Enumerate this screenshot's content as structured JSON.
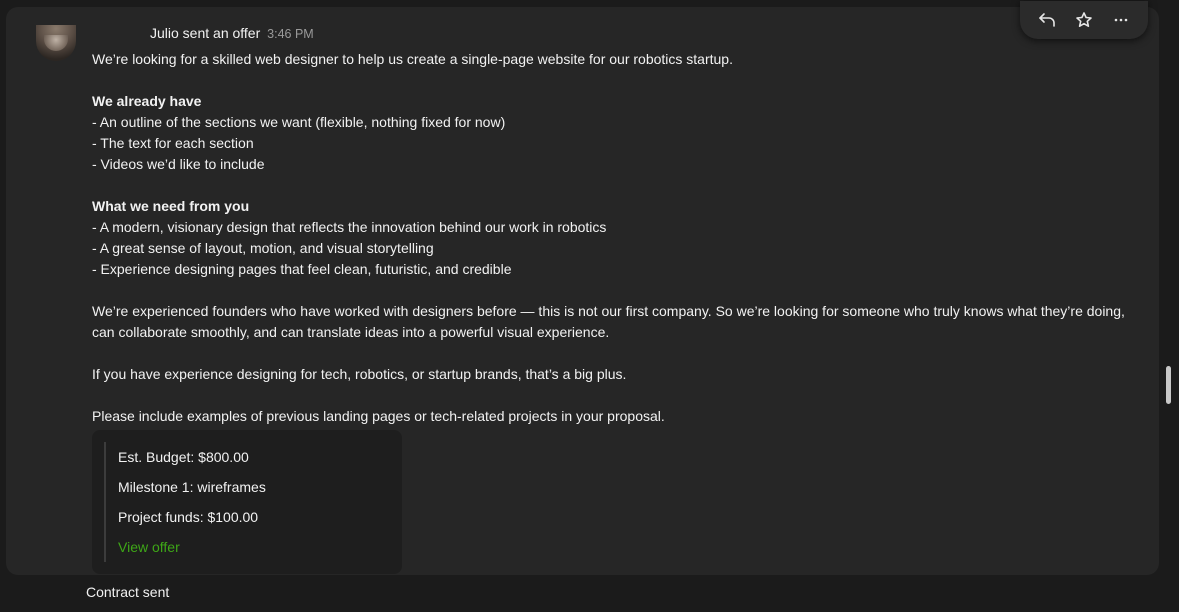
{
  "message": {
    "sender": "Julio sent an offer",
    "timestamp": "3:46 PM",
    "paragraphs": [
      {
        "text": "We’re looking for a skilled web designer to help us create a single-page website for our robotics startup.",
        "bold": false
      },
      {
        "text": "",
        "bold": false
      },
      {
        "text": "We already have",
        "bold": true
      },
      {
        "text": "- An outline of the sections we want (flexible, nothing fixed for now)",
        "bold": false
      },
      {
        "text": "- The text for each section",
        "bold": false
      },
      {
        "text": "- Videos we’d like to include",
        "bold": false
      },
      {
        "text": "",
        "bold": false
      },
      {
        "text": "What we need from you",
        "bold": true
      },
      {
        "text": "- A modern, visionary design that reflects the innovation behind our work in robotics",
        "bold": false
      },
      {
        "text": "- A great sense of layout, motion, and visual storytelling",
        "bold": false
      },
      {
        "text": "- Experience designing pages that feel clean, futuristic, and credible",
        "bold": false
      },
      {
        "text": "",
        "bold": false
      },
      {
        "text": "We’re experienced founders who have worked with designers before — this is not our first company. So we’re looking for someone who truly knows what they’re doing, can collaborate smoothly, and can translate ideas into a powerful visual experience.",
        "bold": false
      },
      {
        "text": "",
        "bold": false
      },
      {
        "text": "If you have experience designing for tech, robotics, or startup brands, that’s a big plus.",
        "bold": false
      },
      {
        "text": "",
        "bold": false
      },
      {
        "text": "Please include examples of previous landing pages or tech-related projects in your proposal.",
        "bold": false
      }
    ]
  },
  "offer": {
    "budget": "Est. Budget: $800.00",
    "milestone": "Milestone 1: wireframes",
    "funds": "Project funds: $100.00",
    "view_link": "View offer"
  },
  "toolbar": {
    "icons": [
      "reply-icon",
      "star-icon",
      "more-icon"
    ]
  },
  "status": {
    "text": "Contract sent"
  },
  "colors": {
    "accent_green": "#3ea717",
    "background": "#1b1b1b",
    "card": "#262626"
  }
}
